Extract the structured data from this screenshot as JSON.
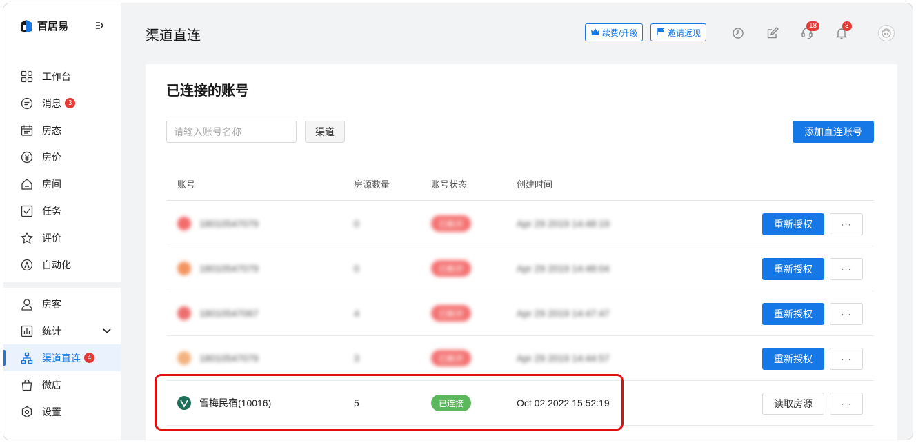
{
  "app": {
    "logo_text": "百居易",
    "page_title": "渠道直连"
  },
  "sidebar": {
    "items": [
      {
        "label": "工作台",
        "icon": "grid-icon"
      },
      {
        "label": "消息",
        "icon": "message-icon",
        "badge": "3"
      },
      {
        "label": "房态",
        "icon": "calendar-icon"
      },
      {
        "label": "房价",
        "icon": "yen-icon"
      },
      {
        "label": "房间",
        "icon": "house-icon"
      },
      {
        "label": "任务",
        "icon": "checkbox-icon"
      },
      {
        "label": "评价",
        "icon": "star-icon"
      },
      {
        "label": "自动化",
        "icon": "auto-icon"
      }
    ],
    "items2": [
      {
        "label": "房客",
        "icon": "user-icon"
      },
      {
        "label": "统计",
        "icon": "chart-icon"
      },
      {
        "label": "渠道直连",
        "icon": "network-icon",
        "badge": "4",
        "active": true
      },
      {
        "label": "微店",
        "icon": "shop-bag-icon"
      },
      {
        "label": "设置",
        "icon": "settings-icon"
      }
    ]
  },
  "header": {
    "renew_label": "续费/升级",
    "invite_label": "邀请返现",
    "support_badge": "18",
    "notify_badge": "3"
  },
  "main": {
    "title": "已连接的账号",
    "search_placeholder": "请输入账号名称",
    "channel_label": "渠道",
    "add_label": "添加直连账号",
    "columns": [
      "账号",
      "房源数量",
      "账号状态",
      "创建时间"
    ],
    "rows": [
      {
        "account": "18010547079",
        "count": "0",
        "status": "已断开",
        "created": "Apr 29 2019 14:48:19",
        "action": "重新授权",
        "blurred": true,
        "logo_color": "#f04848",
        "status_type": "err"
      },
      {
        "account": "18010547079",
        "count": "0",
        "status": "已断开",
        "created": "Apr 29 2019 14:48:04",
        "action": "重新授权",
        "blurred": true,
        "logo_color": "#f07a3a",
        "status_type": "err"
      },
      {
        "account": "18010547067",
        "count": "4",
        "status": "已断开",
        "created": "Apr 29 2019 14:47:47",
        "action": "重新授权",
        "blurred": true,
        "logo_color": "#e84c4c",
        "status_type": "err"
      },
      {
        "account": "18010547079",
        "count": "3",
        "status": "已断开",
        "created": "Apr 29 2019 14:44:57",
        "action": "重新授权",
        "blurred": true,
        "logo_color": "#f0a060",
        "status_type": "err"
      },
      {
        "account": "雪梅民宿(10016)",
        "count": "5",
        "status": "已连接",
        "created": "Oct 02 2022 15:52:19",
        "action": "读取房源",
        "blurred": false,
        "logo_color": "#1f6e5a",
        "status_type": "ok"
      }
    ],
    "more_label": "···"
  },
  "colors": {
    "accent": "#1677e6",
    "danger": "#e53935",
    "success": "#5cb85c"
  }
}
